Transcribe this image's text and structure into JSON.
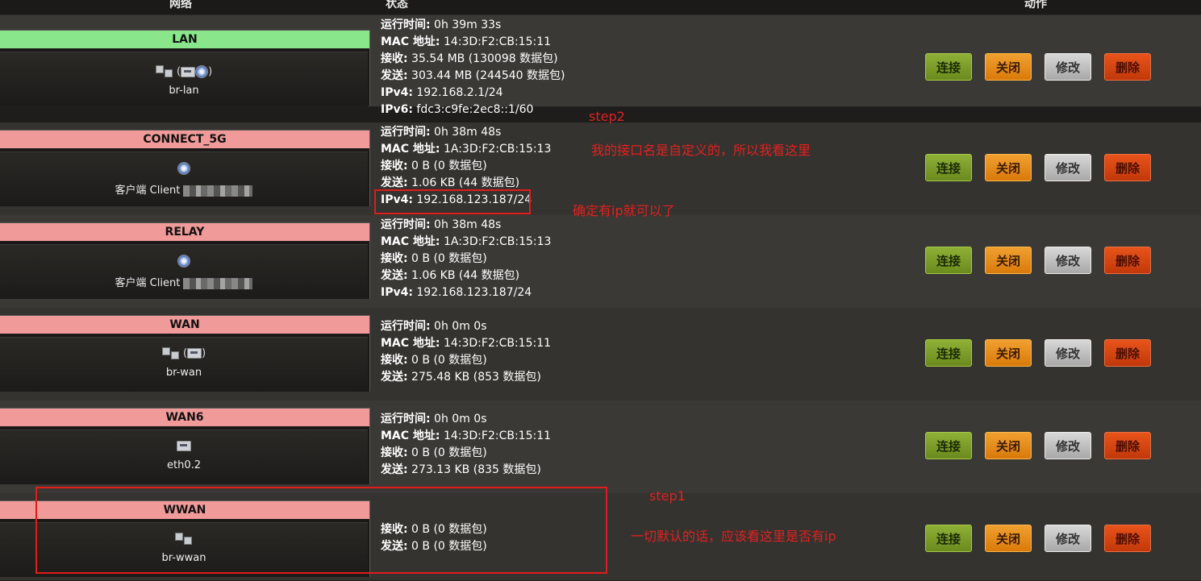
{
  "header": {
    "col_network": "网络",
    "col_status": "状态",
    "col_actions": "动作"
  },
  "interfaces": [
    {
      "name": "LAN",
      "bar_color": "#8ae68a",
      "device": "br-lan",
      "status": [
        {
          "label": "运行时间:",
          "value": " 0h 39m 33s"
        },
        {
          "label": "MAC 地址:",
          "value": " 14:3D:F2:CB:15:11"
        },
        {
          "label": "接收:",
          "value": " 35.54 MB (130098 数据包)"
        },
        {
          "label": "发送:",
          "value": " 303.44 MB (244540 数据包)"
        },
        {
          "label": "IPv4:",
          "value": " 192.168.2.1/24"
        },
        {
          "label": "IPv6:",
          "value": " fdc3:c9fe:2ec8::1/60"
        }
      ]
    },
    {
      "name": "CONNECT_5G",
      "bar_color": "#f09a9a",
      "device": "客户端 Client",
      "status": [
        {
          "label": "运行时间:",
          "value": " 0h 38m 48s"
        },
        {
          "label": "MAC 地址:",
          "value": " 1A:3D:F2:CB:15:13"
        },
        {
          "label": "接收:",
          "value": " 0 B (0 数据包)"
        },
        {
          "label": "发送:",
          "value": " 1.06 KB (44 数据包)"
        },
        {
          "label": "IPv4:",
          "value": " 192.168.123.187/24"
        }
      ]
    },
    {
      "name": "RELAY",
      "bar_color": "#f09a9a",
      "device": "客户端 Client",
      "status": [
        {
          "label": "运行时间:",
          "value": " 0h 38m 48s"
        },
        {
          "label": "MAC 地址:",
          "value": " 1A:3D:F2:CB:15:13"
        },
        {
          "label": "接收:",
          "value": " 0 B (0 数据包)"
        },
        {
          "label": "发送:",
          "value": " 1.06 KB (44 数据包)"
        },
        {
          "label": "IPv4:",
          "value": " 192.168.123.187/24"
        }
      ]
    },
    {
      "name": "WAN",
      "bar_color": "#f09a9a",
      "device": "br-wan",
      "status": [
        {
          "label": "运行时间:",
          "value": " 0h 0m 0s"
        },
        {
          "label": "MAC 地址:",
          "value": " 14:3D:F2:CB:15:11"
        },
        {
          "label": "接收:",
          "value": " 0 B (0 数据包)"
        },
        {
          "label": "发送:",
          "value": " 275.48 KB (853 数据包)"
        }
      ]
    },
    {
      "name": "WAN6",
      "bar_color": "#f09a9a",
      "device": "eth0.2",
      "status": [
        {
          "label": "运行时间:",
          "value": " 0h 0m 0s"
        },
        {
          "label": "MAC 地址:",
          "value": " 14:3D:F2:CB:15:11"
        },
        {
          "label": "接收:",
          "value": " 0 B (0 数据包)"
        },
        {
          "label": "发送:",
          "value": " 273.13 KB (835 数据包)"
        }
      ]
    },
    {
      "name": "WWAN",
      "bar_color": "#f09a9a",
      "device": "br-wwan",
      "status": [
        {
          "label": "接收:",
          "value": " 0 B (0 数据包)"
        },
        {
          "label": "发送:",
          "value": " 0 B (0 数据包)"
        }
      ]
    }
  ],
  "buttons": {
    "connect": "连接",
    "close": "关闭",
    "edit": "修改",
    "delete": "删除"
  },
  "annotations": {
    "step2": "step2",
    "step2_note": "我的接口名是自定义的，所以我看这里",
    "step2_ip_note": "确定有ip就可以了",
    "step1": "step1",
    "step1_note": "一切默认的话，应该看这里是否有ip",
    "color": "#e22121"
  }
}
